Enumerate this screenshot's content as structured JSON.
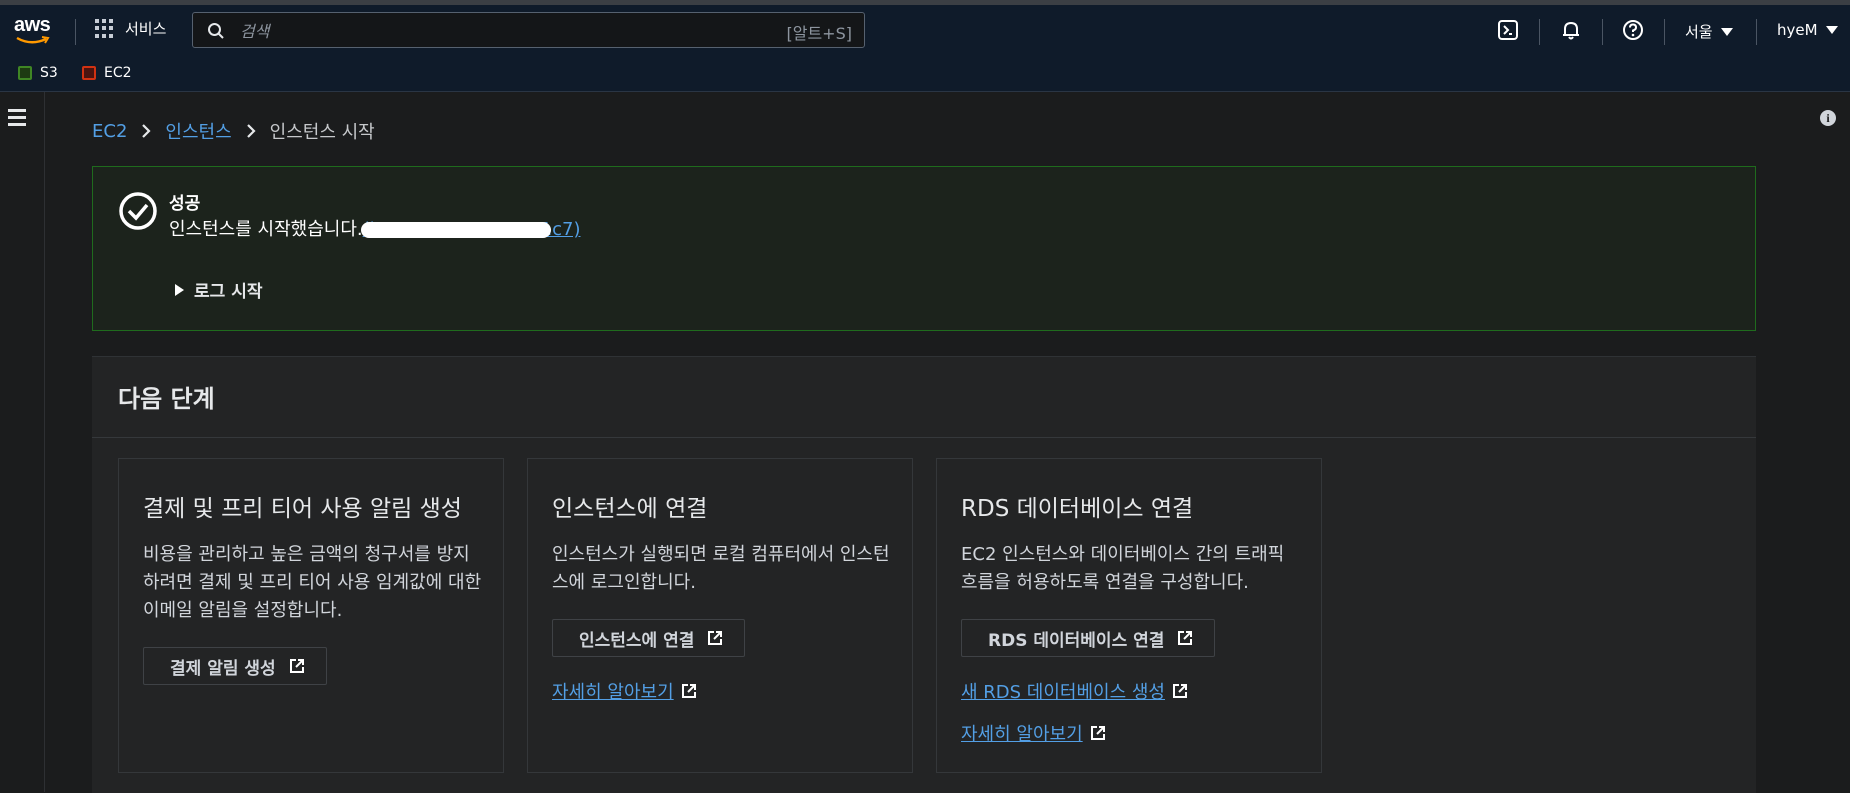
{
  "topnav": {
    "logo_text": "aws",
    "services_label": "서비스",
    "search_placeholder": "검색",
    "search_shortcut": "[알트+S]",
    "region_label": "서울",
    "user_label": "hyeM"
  },
  "favorites": [
    {
      "label": "S3",
      "color": "#3f8624"
    },
    {
      "label": "EC2",
      "color": "#d13212"
    }
  ],
  "breadcrumb": {
    "items": [
      "EC2",
      "인스턴스"
    ],
    "current": "인스턴스 시작"
  },
  "flash": {
    "title": "성공",
    "message": "인스턴스를 시작했습니다.",
    "instance_id": "(i-0123456789a75e1c7)",
    "log_toggle": "로그 시작"
  },
  "next_steps": {
    "title": "다음 단계",
    "cards": [
      {
        "title": "결제 및 프리 티어 사용 알림 생성",
        "description": "비용을 관리하고 높은 금액의 청구서를 방지하려면 결제 및 프리 티어 사용 임계값에 대한 이메일 알림을 설정합니다.",
        "button": "결제 알림 생성"
      },
      {
        "title": "인스턴스에 연결",
        "description": "인스턴스가 실행되면 로컬 컴퓨터에서 인스턴스에 로그인합니다.",
        "button": "인스턴스에 연결",
        "links": [
          "자세히 알아보기"
        ]
      },
      {
        "title": "RDS 데이터베이스 연결",
        "description": "EC2 인스턴스와 데이터베이스 간의 트래픽 흐름을 허용하도록 연결을 구성합니다.",
        "button": "RDS 데이터베이스 연결",
        "links": [
          "새 RDS 데이터베이스 생성",
          "자세히 알아보기"
        ]
      }
    ]
  },
  "colors": {
    "link": "#539fe5",
    "success_border": "#1f6b1d",
    "nav_bg": "#0f1b2a"
  }
}
